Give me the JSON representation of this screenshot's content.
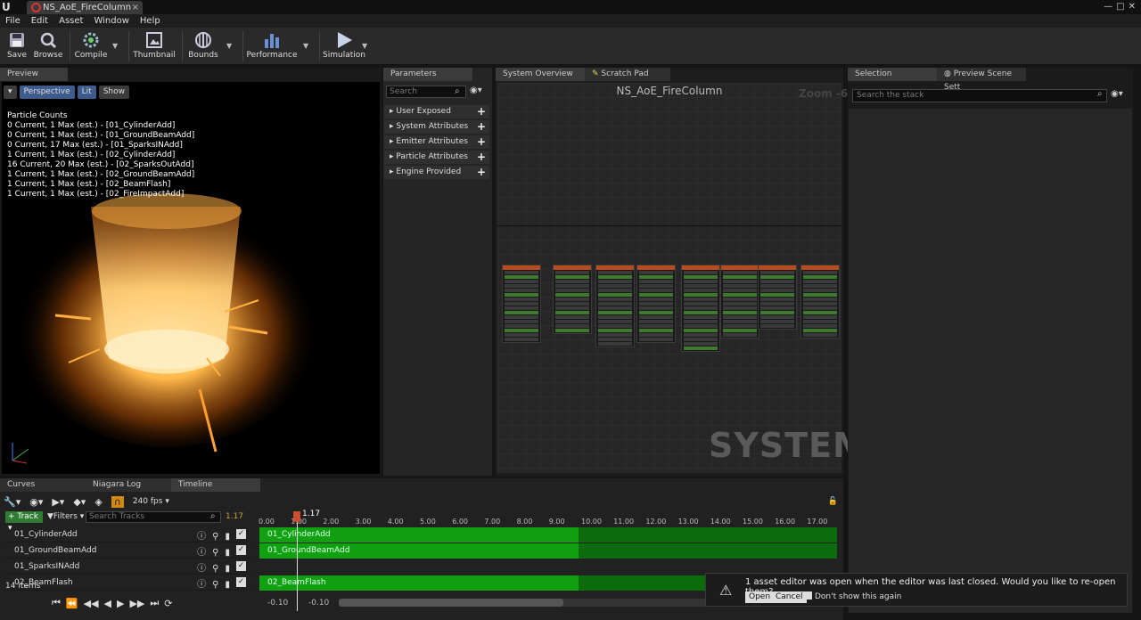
{
  "window": {
    "tab_title": "NS_AoE_FireColumn",
    "controls": [
      "—",
      "□",
      "✕"
    ]
  },
  "menu": [
    "File",
    "Edit",
    "Asset",
    "Window",
    "Help"
  ],
  "toolbar": {
    "save": "Save",
    "browse": "Browse",
    "compile": "Compile",
    "thumbnail": "Thumbnail",
    "bounds": "Bounds",
    "performance": "Performance",
    "simulation": "Simulation"
  },
  "preview": {
    "tab": "Preview",
    "perspective": "Perspective",
    "lit": "Lit",
    "show": "Show",
    "counts_title": "Particle Counts",
    "counts": [
      "0 Current, 1 Max (est.) - [01_CylinderAdd]",
      "0 Current, 1 Max (est.) - [01_GroundBeamAdd]",
      "0 Current, 17 Max (est.) - [01_SparksINAdd]",
      "1 Current, 1 Max (est.) - [02_CylinderAdd]",
      "16 Current, 20 Max (est.) - [02_SparksOutAdd]",
      "1 Current, 1 Max (est.) - [02_GroundBeamAdd]",
      "1 Current, 1 Max (est.) - [02_BeamFlash]",
      "1 Current, 1 Max (est.) - [02_FireImpactAdd]"
    ]
  },
  "parameters": {
    "tab": "Parameters",
    "search_placeholder": "Search",
    "categories": [
      "User Exposed",
      "System Attributes",
      "Emitter Attributes",
      "Particle Attributes",
      "Engine Provided"
    ]
  },
  "system": {
    "tab_overview": "System Overview",
    "tab_scratch": "Scratch Pad",
    "title": "NS_AoE_FireColumn",
    "zoom": "Zoom -6",
    "watermark": "SYSTEM"
  },
  "selection": {
    "tab": "Selection",
    "tab_preview_scene": "Preview Scene Sett",
    "search_placeholder": "Search the stack"
  },
  "timeline": {
    "tabs": [
      "Curves",
      "Niagara Log",
      "Timeline"
    ],
    "fps": "240 fps",
    "track_btn": "Track",
    "filters_btn": "Filters",
    "search_placeholder": "Search Tracks",
    "current_time": "1.17",
    "playhead": "1.17",
    "items_count": "14 items",
    "ruler": [
      "0.00",
      "1.00",
      "2.00",
      "3.00",
      "4.00",
      "5.00",
      "6.00",
      "7.00",
      "8.00",
      "9.00",
      "10.00",
      "11.00",
      "12.00",
      "13.00",
      "14.00",
      "15.00",
      "16.00",
      "17.00"
    ],
    "tracks": [
      "01_CylinderAdd",
      "01_GroundBeamAdd",
      "01_SparksINAdd",
      "02_BeamFlash"
    ],
    "bars": [
      "01_CylinderAdd",
      "01_GroundBeamAdd",
      "02_BeamFlash"
    ],
    "range_start": "-0.10",
    "range_end": "-0.10"
  },
  "notification": {
    "message": "1 asset editor was open when the editor was last closed. Would you like to re-open them?",
    "open": "Open",
    "cancel": "Cancel",
    "dont_show": "Don't show this again"
  }
}
